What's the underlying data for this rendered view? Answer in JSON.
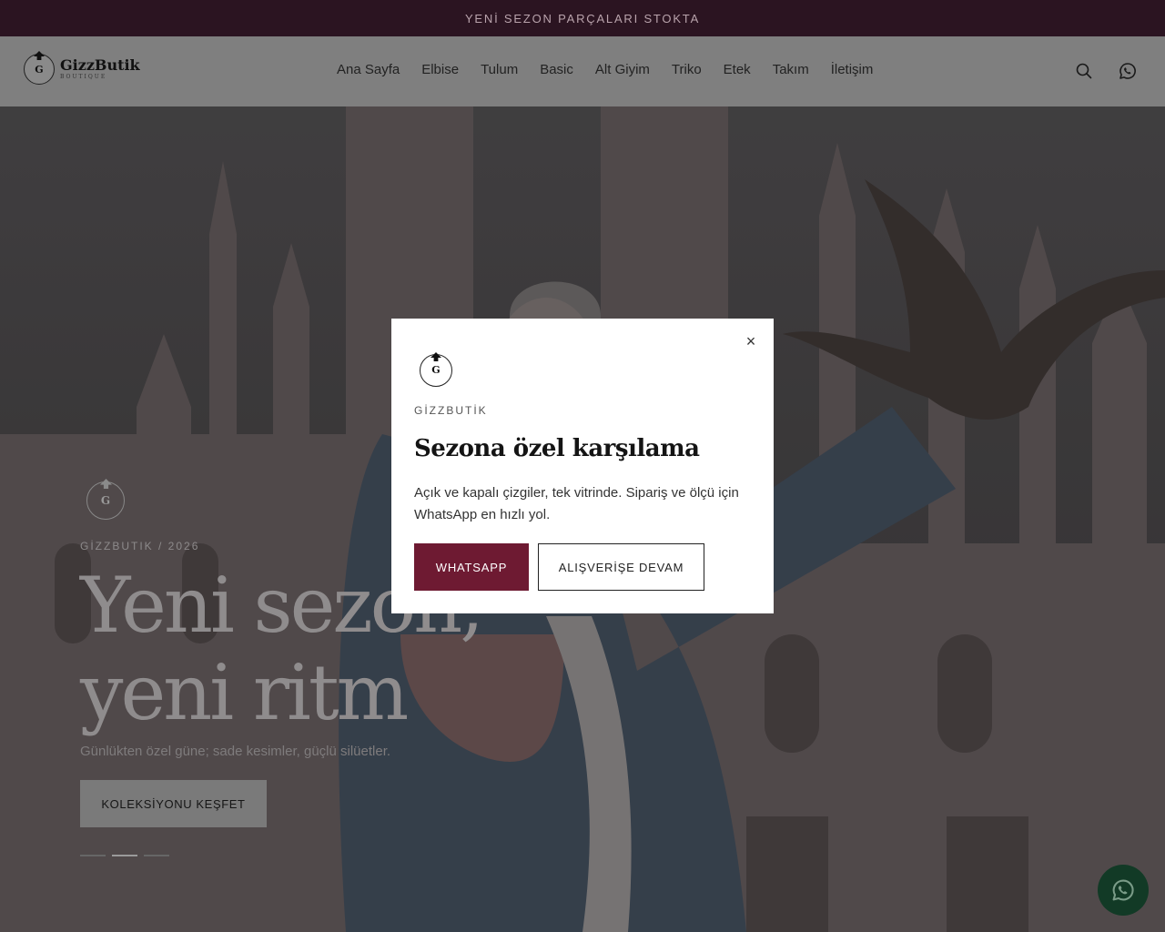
{
  "announcement": {
    "text": "YENİ SEZON PARÇALARI STOKTA"
  },
  "header": {
    "logo": {
      "mark_letter": "G",
      "name": "GizzButik",
      "tagline": "BOUTIQUE"
    },
    "nav": [
      "Ana Sayfa",
      "Elbise",
      "Tulum",
      "Basic",
      "Alt Giyim",
      "Triko",
      "Etek",
      "Takım",
      "İletişim"
    ],
    "icons": [
      "search-icon",
      "whatsapp-icon"
    ]
  },
  "hero": {
    "logo_letter": "G",
    "eyebrow": "GİZZBUTIK / 2026",
    "title_line1": "Yeni sezon,",
    "title_line2": "yeni ritm",
    "subtitle": "Günlükten özel güne; sade kesimler, güçlü silüetler.",
    "cta": "KOLEKSİYONU KEŞFET",
    "slides": 3,
    "active_slide": 2
  },
  "modal": {
    "close_label": "×",
    "logo_letter": "G",
    "brand": "GİZZBUTİK",
    "title": "Sezona özel karşılama",
    "body": "Açık ve kapalı çizgiler, tek vitrinde. Sipariş ve ölçü için WhatsApp en hızlı yol.",
    "primary_button": "WHATSAPP",
    "secondary_button": "ALIŞVERİŞE DEVAM"
  },
  "floating": {
    "icon": "whatsapp-icon"
  },
  "colors": {
    "brand": "#6e1a32",
    "announcement_bg": "#2b1421",
    "fab": "#123a26"
  }
}
